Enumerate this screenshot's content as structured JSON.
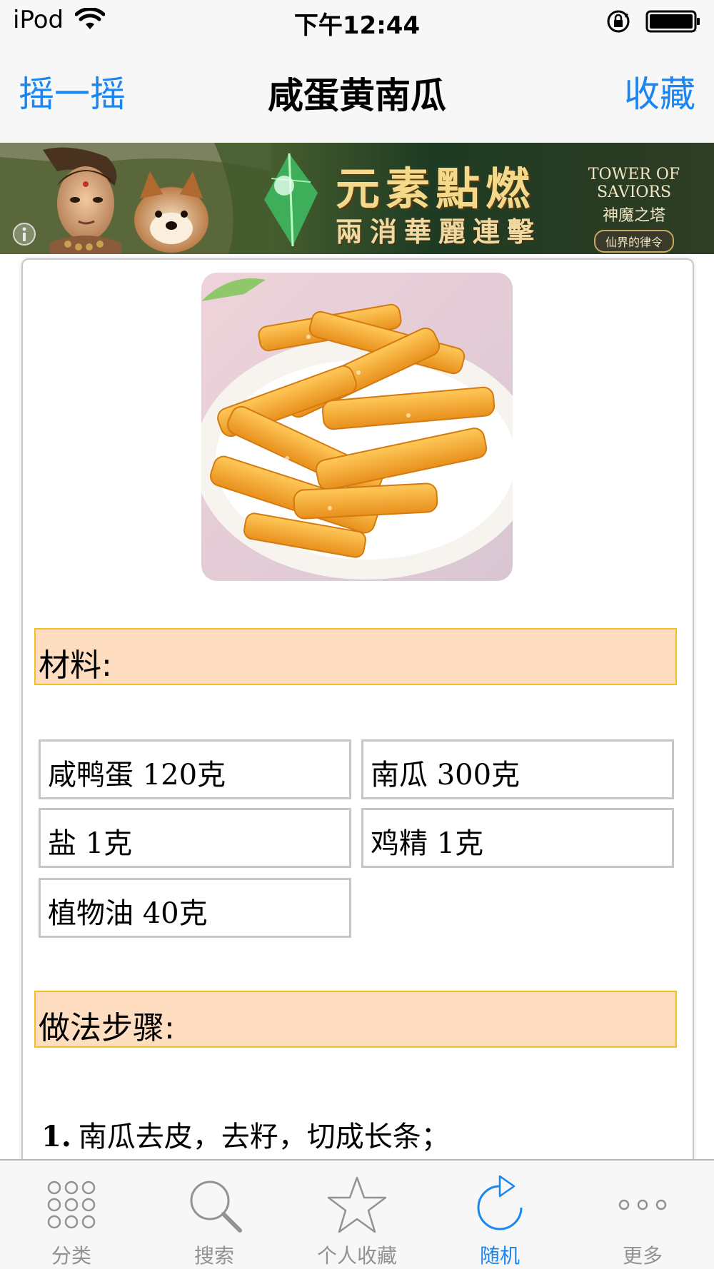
{
  "status_bar": {
    "carrier": "iPod",
    "time": "下午12:44"
  },
  "nav": {
    "left_button": "摇一摇",
    "title": "咸蛋黄南瓜",
    "right_button": "收藏"
  },
  "ad": {
    "headline": "元素點燃",
    "subline": "兩消華麗連擊",
    "brand_en": "TOWER OF SAVIORS",
    "brand_cn": "神魔之塔",
    "brand_tag": "仙界的律令"
  },
  "recipe": {
    "ingredients_header": "材料:",
    "ingredients": [
      "咸鸭蛋 120克",
      "南瓜 300克",
      "盐 1克",
      "鸡精 1克",
      "植物油 40克"
    ],
    "steps_header": "做法步骤:",
    "steps": [
      {
        "num": "1.",
        "text": "南瓜去皮，去籽，切成长条；"
      }
    ]
  },
  "tab_bar": {
    "tabs": [
      {
        "label": "分类",
        "icon": "grid-icon",
        "active": false
      },
      {
        "label": "搜索",
        "icon": "search-icon",
        "active": false
      },
      {
        "label": "个人收藏",
        "icon": "star-icon",
        "active": false
      },
      {
        "label": "随机",
        "icon": "refresh-icon",
        "active": true
      },
      {
        "label": "更多",
        "icon": "more-icon",
        "active": false
      }
    ]
  },
  "colors": {
    "accent": "#1a86f2",
    "section_bg": "#ffddc0",
    "section_border": "#f5c025",
    "tab_inactive": "#929292"
  }
}
